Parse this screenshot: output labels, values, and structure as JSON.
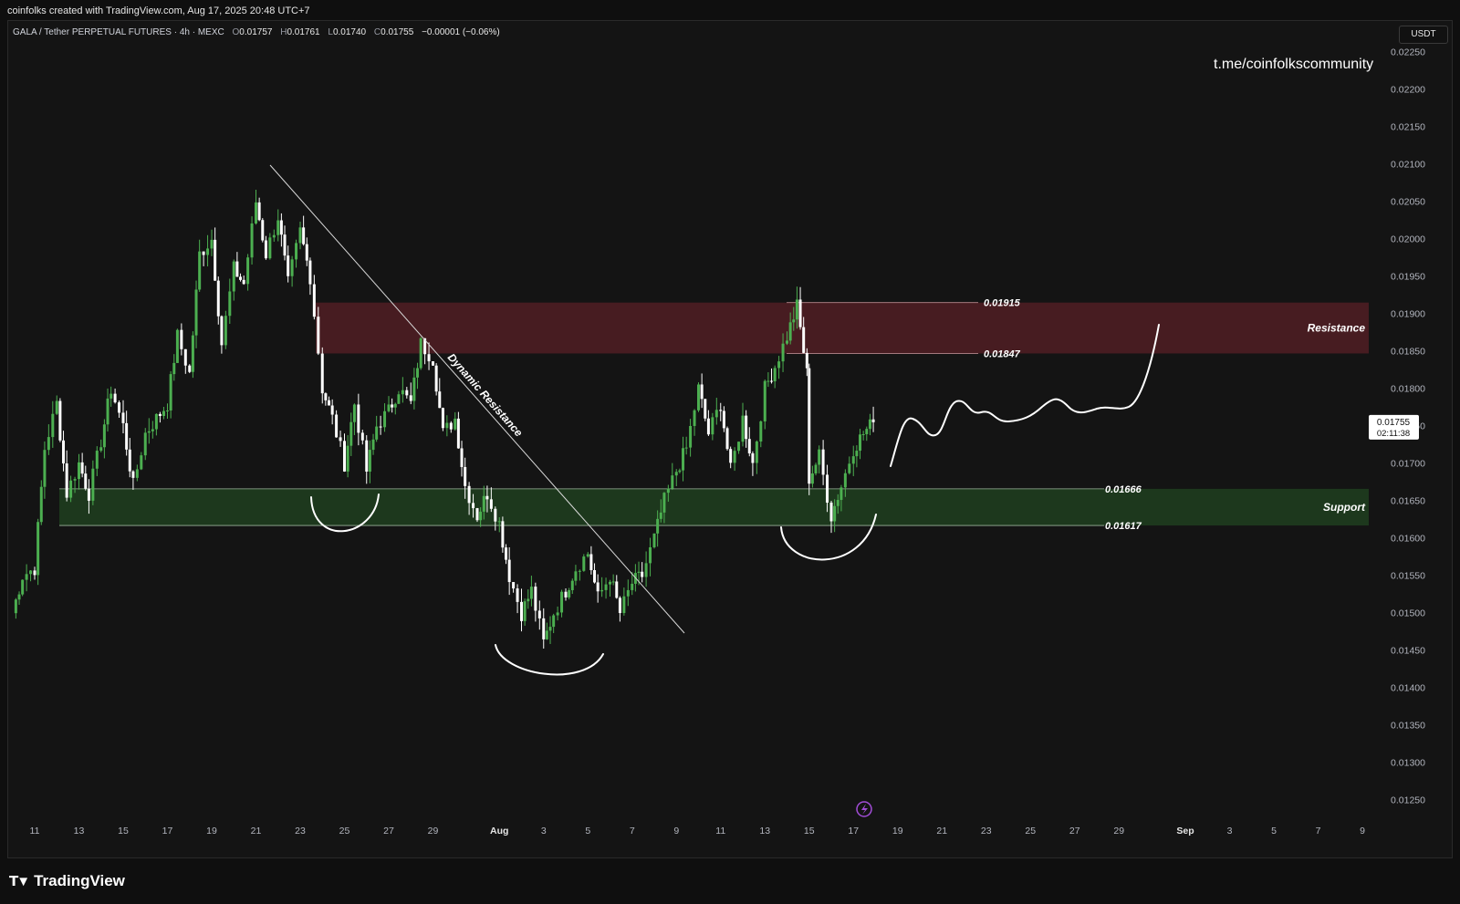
{
  "credit": "coinfolks created with TradingView.com, Aug 17, 2025 20:48 UTC+7",
  "legend": {
    "symbol": "GALA / Tether PERPETUAL FUTURES · 4h · MEXC",
    "open_label": "O",
    "open": "0.01757",
    "high_label": "H",
    "high": "0.01761",
    "low_label": "L",
    "low": "0.01740",
    "close_label": "C",
    "close": "0.01755",
    "change": "−0.00001 (−0.06%)"
  },
  "currency": "USDT",
  "telegram": "t.me/coinfolkscommunity",
  "footer_brand": "TradingView",
  "footer_brand_icon": "tradingview-logo-icon",
  "colors": {
    "up": "#4caf50",
    "down": "#ffffff",
    "resistance_zone": "#4a1c22",
    "support_zone": "#1e3a1e"
  },
  "chart_data": {
    "type": "candlestick",
    "timeframe": "4h",
    "ylim": [
      0.0122,
      0.0227
    ],
    "y_ticks": [
      "0.02250",
      "0.02200",
      "0.02150",
      "0.02100",
      "0.02050",
      "0.02000",
      "0.01950",
      "0.01900",
      "0.01850",
      "0.01800",
      "0.01750",
      "0.01700",
      "0.01650",
      "0.01600",
      "0.01550",
      "0.01500",
      "0.01450",
      "0.01400",
      "0.01350",
      "0.01300",
      "0.01250"
    ],
    "x_ticks": [
      "11",
      "13",
      "15",
      "17",
      "19",
      "21",
      "23",
      "25",
      "27",
      "29",
      "Aug",
      "3",
      "5",
      "7",
      "9",
      "11",
      "13",
      "15",
      "17",
      "19",
      "21",
      "23",
      "25",
      "27",
      "29",
      "Sep",
      "3",
      "5",
      "7",
      "9"
    ],
    "last_price": "0.01755",
    "countdown": "02:11:38",
    "zones": [
      {
        "name": "Resistance",
        "top": 0.01915,
        "bottom": 0.01847,
        "top_label": "0.01915",
        "bottom_label": "0.01847"
      },
      {
        "name": "Support",
        "top": 0.01666,
        "bottom": 0.01617,
        "top_label": "0.01666",
        "bottom_label": "0.01617"
      }
    ],
    "trendline_label": "Dynamic Resistance",
    "close_path": [
      [
        "Jul 10",
        0.015
      ],
      [
        "Jul 10",
        0.0155
      ],
      [
        "Jul 11",
        0.0156
      ],
      [
        "Jul 11",
        0.0172
      ],
      [
        "Jul 12",
        0.0178
      ],
      [
        "Jul 12",
        0.0166
      ],
      [
        "Jul 13",
        0.017
      ],
      [
        "Jul 13",
        0.0166
      ],
      [
        "Jul 14",
        0.0173
      ],
      [
        "Jul 14",
        0.018
      ],
      [
        "Jul 15",
        0.0175
      ],
      [
        "Jul 15",
        0.0167
      ],
      [
        "Jul 16",
        0.0174
      ],
      [
        "Jul 17",
        0.0178
      ],
      [
        "Jul 17",
        0.0187
      ],
      [
        "Jul 18",
        0.0182
      ],
      [
        "Jul 18",
        0.0198
      ],
      [
        "Jul 19",
        0.02
      ],
      [
        "Jul 19",
        0.0186
      ],
      [
        "Jul 20",
        0.0196
      ],
      [
        "Jul 20",
        0.0194
      ],
      [
        "Jul 21",
        0.0205
      ],
      [
        "Jul 21",
        0.0198
      ],
      [
        "Jul 22",
        0.0203
      ],
      [
        "Jul 22",
        0.0194
      ],
      [
        "Jul 23",
        0.0201
      ],
      [
        "Jul 23",
        0.0195
      ],
      [
        "Jul 24",
        0.018
      ],
      [
        "Jul 24",
        0.0176
      ],
      [
        "Jul 25",
        0.017
      ],
      [
        "Jul 25",
        0.0178
      ],
      [
        "Jul 26",
        0.0169
      ],
      [
        "Jul 26",
        0.0175
      ],
      [
        "Jul 27",
        0.0177
      ],
      [
        "Jul 27",
        0.018
      ],
      [
        "Jul 28",
        0.0178
      ],
      [
        "Jul 28",
        0.0186
      ],
      [
        "Jul 29",
        0.0184
      ],
      [
        "Jul 29",
        0.0174
      ],
      [
        "Jul 30",
        0.0176
      ],
      [
        "Jul 30",
        0.0167
      ],
      [
        "Jul 31",
        0.0163
      ],
      [
        "Jul 31",
        0.0166
      ],
      [
        "Aug 1",
        0.0162
      ],
      [
        "Aug 1",
        0.0155
      ],
      [
        "Aug 2",
        0.015
      ],
      [
        "Aug 2",
        0.0153
      ],
      [
        "Aug 3",
        0.0146
      ],
      [
        "Aug 3",
        0.015
      ],
      [
        "Aug 4",
        0.0153
      ],
      [
        "Aug 4",
        0.0156
      ],
      [
        "Aug 5",
        0.0158
      ],
      [
        "Aug 5",
        0.0152
      ],
      [
        "Aug 6",
        0.0155
      ],
      [
        "Aug 6",
        0.015
      ],
      [
        "Aug 7",
        0.0154
      ],
      [
        "Aug 7",
        0.0155
      ],
      [
        "Aug 8",
        0.016
      ],
      [
        "Aug 8",
        0.0165
      ],
      [
        "Aug 9",
        0.0169
      ],
      [
        "Aug 9",
        0.0172
      ],
      [
        "Aug 10",
        0.018
      ],
      [
        "Aug 10",
        0.0174
      ],
      [
        "Aug 11",
        0.0178
      ],
      [
        "Aug 11",
        0.0169
      ],
      [
        "Aug 12",
        0.0176
      ],
      [
        "Aug 12",
        0.017
      ],
      [
        "Aug 13",
        0.018
      ],
      [
        "Aug 13",
        0.0183
      ],
      [
        "Aug 14",
        0.0187
      ],
      [
        "Aug 14",
        0.0191
      ],
      [
        "Aug 14",
        0.0182
      ],
      [
        "Aug 15",
        0.0168
      ],
      [
        "Aug 15",
        0.0171
      ],
      [
        "Aug 16",
        0.0163
      ],
      [
        "Aug 16",
        0.0167
      ],
      [
        "Aug 17",
        0.0172
      ],
      [
        "Aug 17",
        0.0174
      ],
      [
        "Aug 17",
        0.01755
      ]
    ]
  }
}
